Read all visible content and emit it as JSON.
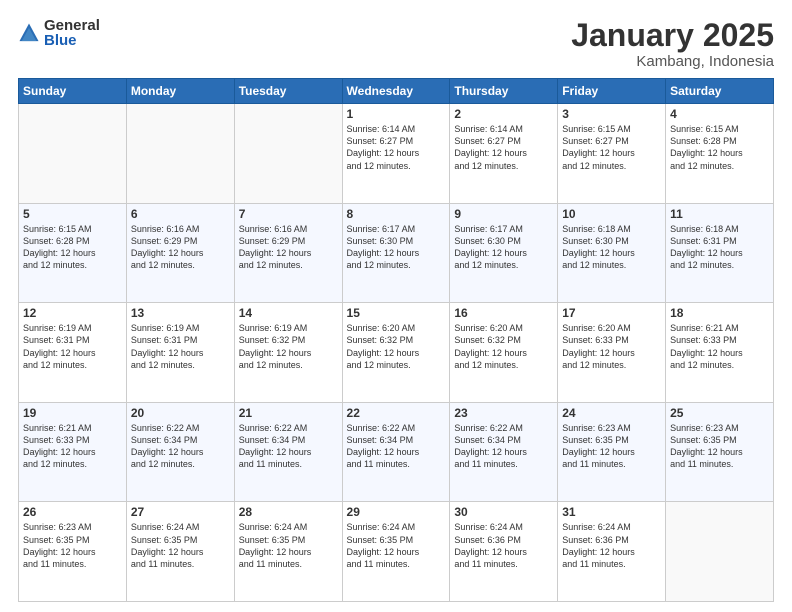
{
  "header": {
    "logo_general": "General",
    "logo_blue": "Blue",
    "title": "January 2025",
    "subtitle": "Kambang, Indonesia"
  },
  "weekdays": [
    "Sunday",
    "Monday",
    "Tuesday",
    "Wednesday",
    "Thursday",
    "Friday",
    "Saturday"
  ],
  "weeks": [
    [
      {
        "day": "",
        "info": ""
      },
      {
        "day": "",
        "info": ""
      },
      {
        "day": "",
        "info": ""
      },
      {
        "day": "1",
        "info": "Sunrise: 6:14 AM\nSunset: 6:27 PM\nDaylight: 12 hours\nand 12 minutes."
      },
      {
        "day": "2",
        "info": "Sunrise: 6:14 AM\nSunset: 6:27 PM\nDaylight: 12 hours\nand 12 minutes."
      },
      {
        "day": "3",
        "info": "Sunrise: 6:15 AM\nSunset: 6:27 PM\nDaylight: 12 hours\nand 12 minutes."
      },
      {
        "day": "4",
        "info": "Sunrise: 6:15 AM\nSunset: 6:28 PM\nDaylight: 12 hours\nand 12 minutes."
      }
    ],
    [
      {
        "day": "5",
        "info": "Sunrise: 6:15 AM\nSunset: 6:28 PM\nDaylight: 12 hours\nand 12 minutes."
      },
      {
        "day": "6",
        "info": "Sunrise: 6:16 AM\nSunset: 6:29 PM\nDaylight: 12 hours\nand 12 minutes."
      },
      {
        "day": "7",
        "info": "Sunrise: 6:16 AM\nSunset: 6:29 PM\nDaylight: 12 hours\nand 12 minutes."
      },
      {
        "day": "8",
        "info": "Sunrise: 6:17 AM\nSunset: 6:30 PM\nDaylight: 12 hours\nand 12 minutes."
      },
      {
        "day": "9",
        "info": "Sunrise: 6:17 AM\nSunset: 6:30 PM\nDaylight: 12 hours\nand 12 minutes."
      },
      {
        "day": "10",
        "info": "Sunrise: 6:18 AM\nSunset: 6:30 PM\nDaylight: 12 hours\nand 12 minutes."
      },
      {
        "day": "11",
        "info": "Sunrise: 6:18 AM\nSunset: 6:31 PM\nDaylight: 12 hours\nand 12 minutes."
      }
    ],
    [
      {
        "day": "12",
        "info": "Sunrise: 6:19 AM\nSunset: 6:31 PM\nDaylight: 12 hours\nand 12 minutes."
      },
      {
        "day": "13",
        "info": "Sunrise: 6:19 AM\nSunset: 6:31 PM\nDaylight: 12 hours\nand 12 minutes."
      },
      {
        "day": "14",
        "info": "Sunrise: 6:19 AM\nSunset: 6:32 PM\nDaylight: 12 hours\nand 12 minutes."
      },
      {
        "day": "15",
        "info": "Sunrise: 6:20 AM\nSunset: 6:32 PM\nDaylight: 12 hours\nand 12 minutes."
      },
      {
        "day": "16",
        "info": "Sunrise: 6:20 AM\nSunset: 6:32 PM\nDaylight: 12 hours\nand 12 minutes."
      },
      {
        "day": "17",
        "info": "Sunrise: 6:20 AM\nSunset: 6:33 PM\nDaylight: 12 hours\nand 12 minutes."
      },
      {
        "day": "18",
        "info": "Sunrise: 6:21 AM\nSunset: 6:33 PM\nDaylight: 12 hours\nand 12 minutes."
      }
    ],
    [
      {
        "day": "19",
        "info": "Sunrise: 6:21 AM\nSunset: 6:33 PM\nDaylight: 12 hours\nand 12 minutes."
      },
      {
        "day": "20",
        "info": "Sunrise: 6:22 AM\nSunset: 6:34 PM\nDaylight: 12 hours\nand 12 minutes."
      },
      {
        "day": "21",
        "info": "Sunrise: 6:22 AM\nSunset: 6:34 PM\nDaylight: 12 hours\nand 11 minutes."
      },
      {
        "day": "22",
        "info": "Sunrise: 6:22 AM\nSunset: 6:34 PM\nDaylight: 12 hours\nand 11 minutes."
      },
      {
        "day": "23",
        "info": "Sunrise: 6:22 AM\nSunset: 6:34 PM\nDaylight: 12 hours\nand 11 minutes."
      },
      {
        "day": "24",
        "info": "Sunrise: 6:23 AM\nSunset: 6:35 PM\nDaylight: 12 hours\nand 11 minutes."
      },
      {
        "day": "25",
        "info": "Sunrise: 6:23 AM\nSunset: 6:35 PM\nDaylight: 12 hours\nand 11 minutes."
      }
    ],
    [
      {
        "day": "26",
        "info": "Sunrise: 6:23 AM\nSunset: 6:35 PM\nDaylight: 12 hours\nand 11 minutes."
      },
      {
        "day": "27",
        "info": "Sunrise: 6:24 AM\nSunset: 6:35 PM\nDaylight: 12 hours\nand 11 minutes."
      },
      {
        "day": "28",
        "info": "Sunrise: 6:24 AM\nSunset: 6:35 PM\nDaylight: 12 hours\nand 11 minutes."
      },
      {
        "day": "29",
        "info": "Sunrise: 6:24 AM\nSunset: 6:35 PM\nDaylight: 12 hours\nand 11 minutes."
      },
      {
        "day": "30",
        "info": "Sunrise: 6:24 AM\nSunset: 6:36 PM\nDaylight: 12 hours\nand 11 minutes."
      },
      {
        "day": "31",
        "info": "Sunrise: 6:24 AM\nSunset: 6:36 PM\nDaylight: 12 hours\nand 11 minutes."
      },
      {
        "day": "",
        "info": ""
      }
    ]
  ]
}
